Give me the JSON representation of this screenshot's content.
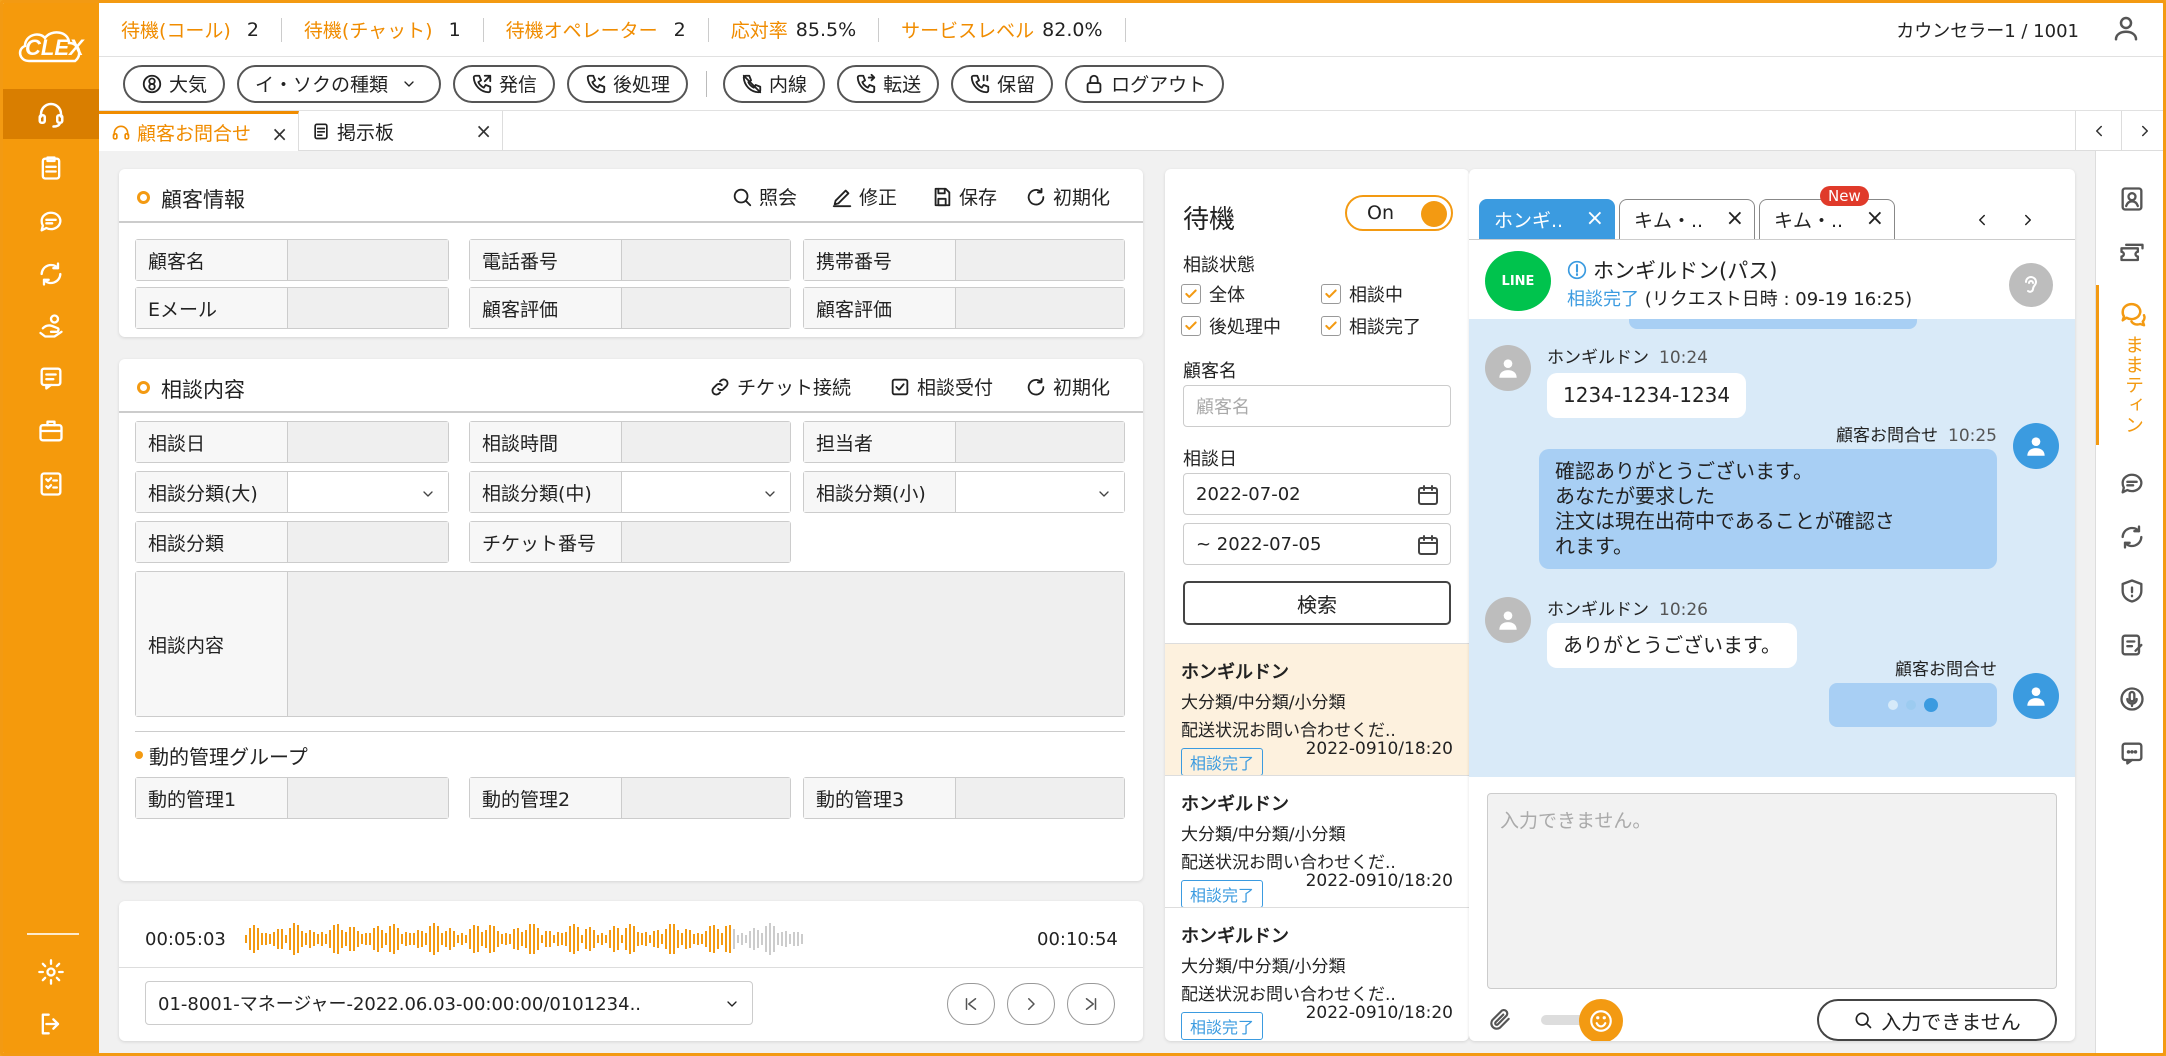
{
  "app": {
    "logo_text": "CLEX"
  },
  "status": [
    {
      "label": "待機(コール)",
      "value": "2"
    },
    {
      "label": "待機(チャット)",
      "value": "1"
    },
    {
      "label": "待機オペレーター",
      "value": "2"
    },
    {
      "label": "応対率",
      "value": "85.5%"
    },
    {
      "label": "サービスレベル",
      "value": "82.0%"
    }
  ],
  "user": {
    "name": "カウンセラー1 / 1001"
  },
  "toolbar": {
    "status_btn": "大気",
    "reason_select": "イ・ソクの種類",
    "dial": "発信",
    "after_work": "後処理",
    "internal": "内線",
    "transfer": "転送",
    "hold": "保留",
    "logout": "ログアウト"
  },
  "tabs": [
    {
      "label": "顧客お問合せ"
    },
    {
      "label": "掲示板"
    }
  ],
  "customer": {
    "title": "顧客情報",
    "actions": {
      "inquiry": "照会",
      "edit": "修正",
      "save": "保存",
      "reset": "初期化"
    },
    "fields": {
      "name": "顧客名",
      "phone": "電話番号",
      "mobile": "携帯番号",
      "email": "Eメール",
      "rating1": "顧客評価",
      "rating2": "顧客評価"
    }
  },
  "consult": {
    "title": "相談内容",
    "actions": {
      "ticket": "チケット接続",
      "accept": "相談受付",
      "reset": "初期化"
    },
    "fields": {
      "date": "相談日",
      "time": "相談時間",
      "owner": "担当者",
      "cat_l": "相談分類(大)",
      "cat_m": "相談分類(中)",
      "cat_s": "相談分類(小)",
      "cat": "相談分類",
      "ticket_no": "チケット番号",
      "content": "相談内容"
    },
    "group_title": "動的管理グループ",
    "group": {
      "d1": "動的管理1",
      "d2": "動的管理2",
      "d3": "動的管理3"
    }
  },
  "audio": {
    "elapsed": "00:05:03",
    "total": "00:10:54",
    "progress": 0.87,
    "file": "01-8001-マネージャー-2022.06.03-00:00:00/0101234.."
  },
  "waiting": {
    "title": "待機",
    "toggle": "On",
    "status_label": "相談状態",
    "checks": [
      "全体",
      "相談中",
      "後処理中",
      "相談完了"
    ],
    "name_label": "顧客名",
    "name_placeholder": "顧客名",
    "date_label": "相談日",
    "date_from": "2022-07-02",
    "date_to": "~ 2022-07-05",
    "search": "検索",
    "items": [
      {
        "name": "ホンギルドン",
        "category": "大分類/中分類/小分類",
        "desc": "配送状況お問い合わせくだ..",
        "badge": "相談完了",
        "date": "2022-0910/18:20"
      },
      {
        "name": "ホンギルドン",
        "category": "大分類/中分類/小分類",
        "desc": "配送状況お問い合わせくだ..",
        "badge": "相談完了",
        "date": "2022-0910/18:20"
      },
      {
        "name": "ホンギルドン",
        "category": "大分類/中分類/小分類",
        "desc": "配送状況お問い合わせくだ..",
        "badge": "相談完了",
        "date": "2022-0910/18:20"
      }
    ]
  },
  "chat": {
    "tabs": [
      {
        "label": "ホンギ.."
      },
      {
        "label": "キム・.."
      },
      {
        "label": "キム・..",
        "badge": "New"
      }
    ],
    "line_logo": "LINE",
    "header_name": "ホンギルドン(パス)",
    "header_status": "相談完了",
    "header_request": "(リクエスト日時 : 09-19 16:25)",
    "messages": [
      {
        "sender": "ホンギルドン",
        "time": "10:24",
        "text": "1234-1234-1234"
      },
      {
        "sender": "顧客お問合せ",
        "time": "10:25",
        "lines": [
          "確認ありがとうございます。",
          "あなたが要求した",
          "注文は現在出荷中であることが確認さ",
          "れます。"
        ]
      },
      {
        "sender": "ホンギルドン",
        "time": "10:26",
        "text": "ありがとうございます。"
      },
      {
        "sender": "顧客お問合せ"
      }
    ],
    "input_placeholder": "入力できません。",
    "send": "入力できません"
  },
  "right_sidebar": {
    "active_label": "ままティン"
  },
  "colors": {
    "brand": "#F59A0C",
    "accent": "#F08C00",
    "chat_blue": "#3B9BE0",
    "chat_bg": "#D9EAF8"
  }
}
